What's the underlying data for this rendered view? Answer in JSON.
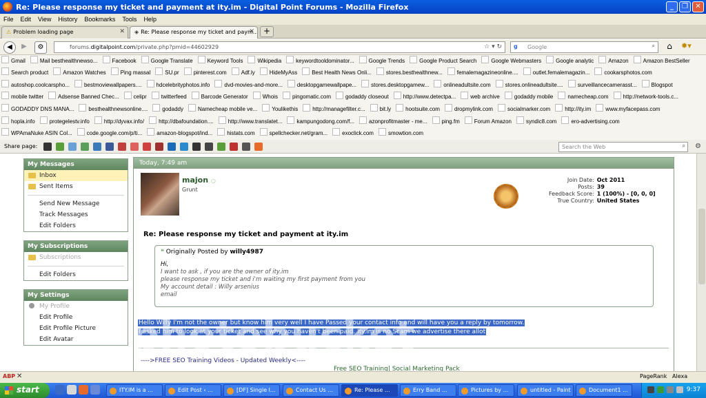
{
  "window": {
    "title": "Re: Please response my ticket and payment at ity.im - Digital Point Forums - Mozilla Firefox"
  },
  "menu": [
    "File",
    "Edit",
    "View",
    "History",
    "Bookmarks",
    "Tools",
    "Help"
  ],
  "tabs": [
    {
      "label": "Problem loading page"
    },
    {
      "label": "Re: Please response my ticket and paym..."
    }
  ],
  "nav": {
    "url_prefix": "forums.",
    "url_domain": "digitalpoint.com",
    "url_path": "/private.php?pmid=44602929",
    "search_placeholder": "Google"
  },
  "bookmarks": [
    [
      "Gmail",
      "Mail besthealthnewso...",
      "Facebook",
      "Google Translate",
      "Keyword Tools",
      "Wikipedia",
      "keywordtooldominator...",
      "Google Trends",
      "Google Product Search",
      "Google Webmasters",
      "Google analytic",
      "Amazon",
      "Amazon BestSeller"
    ],
    [
      "Search product",
      "Amazon Watches",
      "Ping massal",
      "SU.pr",
      "pinterest.com",
      "Adf.ly",
      "HideMyAss",
      "Best Health News Onli...",
      "stores.besthealthnew...",
      "femalemagazineonline....",
      "outlet.femalemagazin...",
      "cookarsphotos.com"
    ],
    [
      "autoshop.coolcarspho...",
      "bestmoviewallpapers....",
      "hdcelebrityphotos.info",
      "dvd-movies-and-more...",
      "desktopgamewallpape...",
      "stores.desktopgamew...",
      "onlineadultsite.com",
      "stores.onlineadultsite....",
      "surveillancecamerasst...",
      "Blogspot"
    ],
    [
      "mobile twitter",
      "Adsense Banned Chec...",
      "celipr",
      "twitterfeed",
      "Barcode Generator",
      "Whois",
      "pingomatic.com",
      "godaddy closeout",
      "http://www.detectpa...",
      "web archive",
      "godaddy mobile",
      "namecheap.com",
      "http://network-tools.c..."
    ],
    [
      "GODADDY DNS MANA...",
      "besthealthnewsonline....",
      "godaddy",
      "Namecheap mobile ve...",
      "Youlikethis",
      "http://managefilter.c...",
      "bit.ly",
      "hootsuite.com",
      "dropmylink.com",
      "socialmarker.com",
      "http://ity.im",
      "www.myfacepass.com"
    ],
    [
      "hopla.info",
      "protegelestv.info",
      "http://dyvax.info/",
      "http://dbafoundation....",
      "http://www.translatet...",
      "kampungodong.com/f...",
      "azonprofitmaster - me...",
      "ping.fm",
      "Forum Amazon",
      "syndic8.com",
      "ero-advertising.com"
    ],
    [
      "WPAmaNuke ASIN Col...",
      "code.google.com/p/ti...",
      "amazon-blogspot/ind...",
      "histats.com",
      "spellchecker.net/gram...",
      "exoclick.com",
      "smowtion.com"
    ]
  ],
  "sharebar": {
    "label": "Share page:",
    "search_placeholder": "Search the Web"
  },
  "sidebar": {
    "messages": {
      "title": "My Messages",
      "inbox": "Inbox",
      "sent": "Sent Items",
      "new": "Send New Message",
      "track": "Track Messages",
      "folders": "Edit Folders"
    },
    "subscriptions": {
      "title": "My Subscriptions",
      "subs": "Subscriptions",
      "folders": "Edit Folders"
    },
    "settings": {
      "title": "My Settings",
      "profile": "My Profile",
      "edit_profile": "Edit Profile",
      "edit_picture": "Edit Profile Picture",
      "edit_avatar": "Edit Avatar"
    }
  },
  "post": {
    "date": "Today, 7:49 am",
    "username": "majon",
    "user_title": "Grunt",
    "stats": [
      {
        "k": "Join Date:",
        "v": "Oct 2011"
      },
      {
        "k": "Posts:",
        "v": "39"
      },
      {
        "k": "Feedback Score:",
        "v": "1 (100%) - [0, 0, 0]"
      },
      {
        "k": "True Country:",
        "v": "United States"
      }
    ],
    "title": "Re: Please response my ticket and payment at ity.im",
    "quote": {
      "by_prefix": "Originally Posted by",
      "by_user": "willy4987",
      "lines": [
        "Hi,",
        "I want to ask , if you are the owner of ity.im",
        "please response my ticket and i'm waiting my first payment from you",
        "My account detail : Willy arsenius",
        "email"
      ]
    },
    "reply_lines": [
      "Hello Willy I'm not the owner but know him very well I have Passed your contact info and will have you a reply by tomorrow.",
      "I asked him to look at your ticket and see why you haven't been paid. Ity.im is no Scam we advertise there allot"
    ],
    "sig1": "---->FREE SEO Training Videos - Updated Weekly<----",
    "sig2": "Free SEO Training| Social Marketing Pack"
  },
  "statusbar": {
    "abp": "ABP",
    "pagerank": "PageRank",
    "alexa": "Alexa"
  },
  "taskbar": {
    "start": "start",
    "tasks": [
      "ITY.IM is a ...",
      "Edit Post ‹ ...",
      "[DF] Single l...",
      "Contact Us ...",
      "Re: Please ...",
      "Erry Band ...",
      "Pictures by ...",
      "untitled - Paint",
      "Document1 ..."
    ],
    "clock": "9:37"
  },
  "watermark": "photobucket"
}
